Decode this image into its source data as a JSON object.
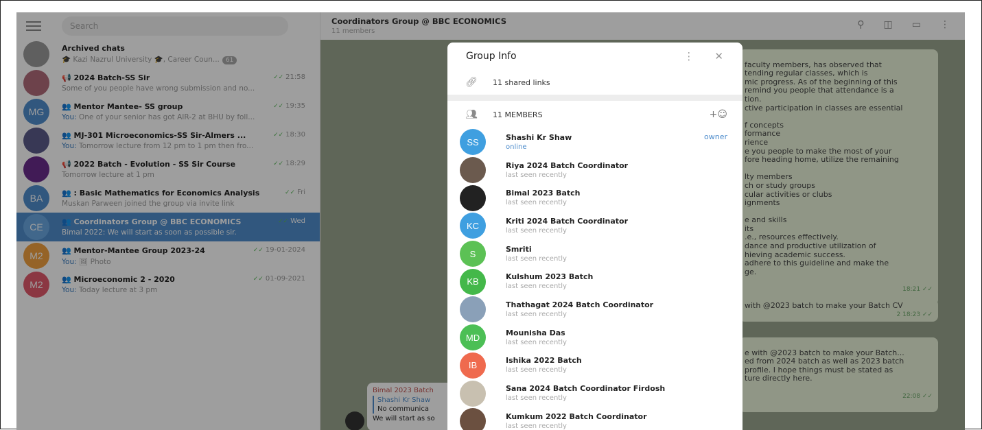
{
  "sidebar": {
    "search_placeholder": "Search",
    "chats": [
      {
        "title": "Archived chats",
        "preview": "🎓 Kazi Nazrul University 🎓, Career Coun...",
        "time": "",
        "you": "",
        "badge": "61",
        "avatar": "",
        "avatar_color": "#9a9a9a",
        "active": false
      },
      {
        "title": "📢 2024 Batch-SS Sir",
        "preview": "Some of you people have wrong submission and no...",
        "time": "21:58",
        "you": "",
        "badge": "",
        "avatar": "",
        "avatar_color": "#b06b7a",
        "active": false
      },
      {
        "title": "👥 Mentor Mantee- SS group",
        "preview": "One of your senior has got AIR-2 at BHU by foll...",
        "time": "19:35",
        "you": "You:",
        "badge": "",
        "avatar": "MG",
        "avatar_color": "#4f8dcc",
        "active": false
      },
      {
        "title": "👥 MJ-301 Microeconomics-SS Sir-Almers ...",
        "preview": "Tomorrow lecture from 12 pm to 1 pm then fro...",
        "time": "18:30",
        "you": "You:",
        "badge": "",
        "avatar": "",
        "avatar_color": "#5b5b8a",
        "active": false
      },
      {
        "title": "📢 2022 Batch - Evolution - SS Sir Course",
        "preview": "Tomorrow lecture at 1 pm",
        "time": "18:29",
        "you": "",
        "badge": "",
        "avatar": "",
        "avatar_color": "#6a2c8c",
        "active": false
      },
      {
        "title": "👥 : Basic Mathematics for Economics Analysis",
        "preview": "Muskan Parween joined the group via invite link",
        "time": "Fri",
        "you": "",
        "badge": "",
        "avatar": "BA",
        "avatar_color": "#4f8dcc",
        "active": false
      },
      {
        "title": "👥 Coordinators Group @ BBC ECONOMICS",
        "preview": "Bimal 2022: We will start as soon as possible sir.",
        "time": "Wed",
        "you": "",
        "badge": "",
        "avatar": "CE",
        "avatar_color": "#6aa7e0",
        "active": true
      },
      {
        "title": "👥 Mentor-Mantee Group 2023-24",
        "preview": "🖼 Photo",
        "time": "19-01-2024",
        "you": "You:",
        "badge": "",
        "avatar": "M2",
        "avatar_color": "#f0a040",
        "active": false
      },
      {
        "title": "👥 Microeconomic 2 - 2020",
        "preview": "Today lecture at 3 pm",
        "time": "01-09-2021",
        "you": "You:",
        "badge": "",
        "avatar": "M2",
        "avatar_color": "#e05a6b",
        "active": false
      }
    ]
  },
  "main": {
    "title": "Coordinators Group @ BBC ECONOMICS",
    "subtitle": "11 members",
    "bubble1": "faculty members, has observed that\ntending regular classes, which is\nmic progress. As of the beginning of this\nremind you people that attendance is a\ntion.\nctive participation in classes are essential\n\nf concepts\nformance\nrience\ne you people to make the most of your\nfore heading home, utilize the remaining\n\nlty members\nch or study groups\ncular activities or clubs\nignments\n\ne and skills\nits\n.e., resources effectively.\ndance and productive utilization of\nhieving academic success.\nadhere to this guideline and make the\nge.",
    "bubble1_time": "18:21",
    "bubble2": "with @2023 batch to make your Batch CV",
    "bubble2_time": "2  18:23",
    "bubble3": "e with @2023 batch to make your Batch...\ned from 2024 batch as well as 2023 batch\nprofile. I hope things must be stated as\nture directly here.",
    "bubble3_time": "22:08",
    "reply_sender": "Bimal 2023 Batch",
    "reply_quote_name": "Shashi Kr Shaw",
    "reply_quote_text": "No communica",
    "reply_text": "We will start as so"
  },
  "modal": {
    "title": "Group Info",
    "shared_links": "11 shared links",
    "members_header": "11 MEMBERS",
    "owner_label": "owner",
    "members": [
      {
        "name": "Shashi Kr Shaw",
        "status": "online",
        "initials": "SS",
        "color": "#3f9fe0",
        "online": true
      },
      {
        "name": "Riya 2024 Batch Coordinator",
        "status": "last seen recently",
        "initials": "",
        "color": "#6b5a4e",
        "online": false
      },
      {
        "name": "Bimal 2023 Batch",
        "status": "last seen recently",
        "initials": "",
        "color": "#222222",
        "online": false
      },
      {
        "name": "Kriti 2024 Batch Coordinator",
        "status": "last seen recently",
        "initials": "KC",
        "color": "#3f9fe0",
        "online": false
      },
      {
        "name": "Smriti",
        "status": "last seen recently",
        "initials": "S",
        "color": "#5cc155",
        "online": false
      },
      {
        "name": "Kulshum 2023 Batch",
        "status": "last seen recently",
        "initials": "KB",
        "color": "#44b84a",
        "online": false
      },
      {
        "name": "Thathagat 2024 Batch Coordinator",
        "status": "last seen recently",
        "initials": "",
        "color": "#8aa0b8",
        "online": false
      },
      {
        "name": "Mounisha Das",
        "status": "last seen recently",
        "initials": "MD",
        "color": "#4cbf55",
        "online": false
      },
      {
        "name": "Ishika 2022 Batch",
        "status": "last seen recently",
        "initials": "IB",
        "color": "#ef6a4e",
        "online": false
      },
      {
        "name": "Sana 2024 Batch Coordinator Firdosh",
        "status": "last seen recently",
        "initials": "",
        "color": "#c8c0b0",
        "online": false
      },
      {
        "name": "Kumkum 2022 Batch Coordinator",
        "status": "last seen recently",
        "initials": "",
        "color": "#6b5040",
        "online": false
      }
    ]
  }
}
